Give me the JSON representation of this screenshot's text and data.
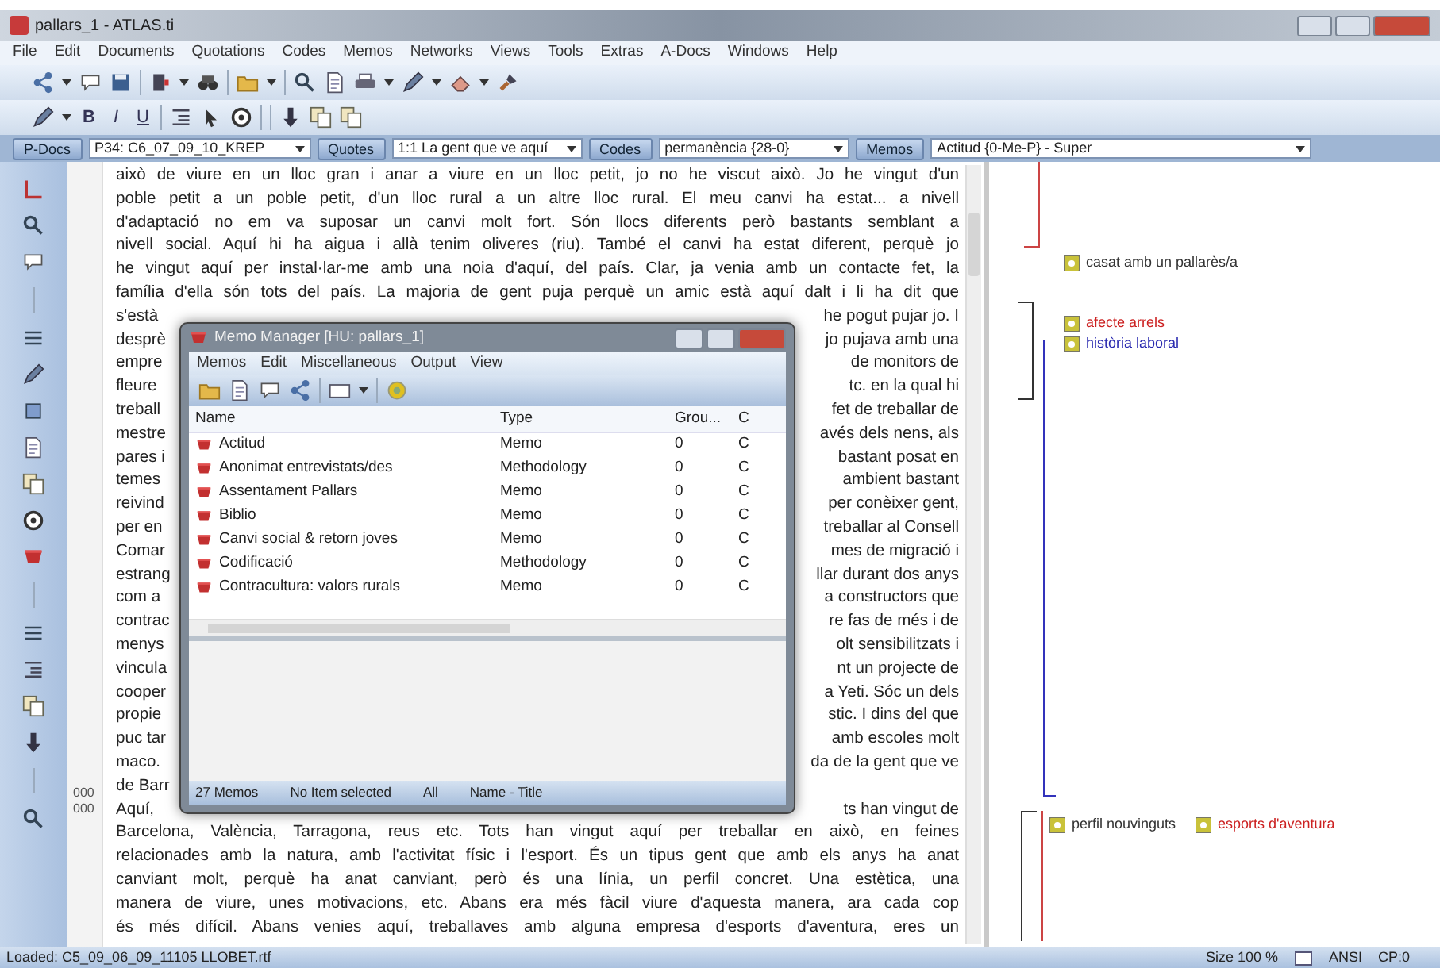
{
  "window": {
    "title": "pallars_1 - ATLAS.ti"
  },
  "menu": [
    "File",
    "Edit",
    "Documents",
    "Quotations",
    "Codes",
    "Memos",
    "Networks",
    "Views",
    "Tools",
    "Extras",
    "A-Docs",
    "Windows",
    "Help"
  ],
  "format_buttons": [
    "B",
    "I",
    "U"
  ],
  "selectors": [
    {
      "button": "P-Docs",
      "value": "P34: C6_07_09_10_KREP"
    },
    {
      "button": "Quotes",
      "value": "1:1 La gent que ve aquí"
    },
    {
      "button": "Codes",
      "value": "permanència {28-0}"
    },
    {
      "button": "Memos",
      "value": "Actitud {0-Me-P} - Super"
    }
  ],
  "document": {
    "lines": [
      {
        "kind": "full",
        "text": "això de viure en un lloc gran i anar a viure en un lloc petit, jo no he viscut això. Jo he vingut d'un"
      },
      {
        "kind": "full",
        "text": "poble petit a un poble petit, d'un lloc rural a un altre lloc rural. El meu canvi ha estat... a nivell"
      },
      {
        "kind": "full",
        "text": "d'adaptació no em va suposar un canvi molt fort. Són llocs diferents però bastants semblant a"
      },
      {
        "kind": "full",
        "text": "nivell social. Aquí hi ha aigua i allà tenim oliveres (riu). També el canvi ha estat diferent, perquè jo"
      },
      {
        "kind": "full",
        "text": "he vingut aquí per instal·lar-me amb una noia d'aquí, del país. Clar, ja venia amb un contacte fet, la"
      },
      {
        "kind": "full",
        "text": "família d'ella són tots del país. La majoria de gent puja perquè un amic està aquí dalt i li ha dit que"
      },
      {
        "kind": "split",
        "left": "s'està",
        "right": "he pogut pujar jo. I"
      },
      {
        "kind": "split",
        "left": "desprè",
        "right": "jo pujava amb una"
      },
      {
        "kind": "split",
        "left": "empre",
        "right": "de monitors de"
      },
      {
        "kind": "split",
        "left": "fleure",
        "right": "tc. en la qual hi"
      },
      {
        "kind": "split",
        "left": "treball",
        "right": "fet de treballar de"
      },
      {
        "kind": "split",
        "left": "mestre",
        "right": "avés dels nens, als"
      },
      {
        "kind": "split",
        "left": "pares i",
        "right": "bastant posat en"
      },
      {
        "kind": "split",
        "left": "temes",
        "right": "ambient bastant"
      },
      {
        "kind": "split",
        "left": "reivind",
        "right": "per conèixer gent,"
      },
      {
        "kind": "split",
        "left": "per en",
        "right": "treballar al Consell"
      },
      {
        "kind": "split",
        "left": "Comar",
        "right": "mes de migració i"
      },
      {
        "kind": "split",
        "left": "estrang",
        "right": "llar durant dos anys"
      },
      {
        "kind": "split",
        "left": "com a",
        "right": "a constructors que"
      },
      {
        "kind": "split",
        "left": "contrac",
        "right": "re fas de més i de"
      },
      {
        "kind": "split",
        "left": "menys",
        "right": "olt sensibilitzats i"
      },
      {
        "kind": "split",
        "left": "vincula",
        "right": "nt un projecte de"
      },
      {
        "kind": "split",
        "left": "cooper",
        "right": "a Yeti. Sóc un dels"
      },
      {
        "kind": "split",
        "left": "propie",
        "right": "stic. I dins del que"
      },
      {
        "kind": "split",
        "left": "puc tar",
        "right": "amb escoles molt"
      },
      {
        "kind": "split",
        "left": "maco.",
        "right": "da de la gent que ve"
      },
      {
        "kind": "split",
        "left": "de Barr"
      },
      {
        "kind": "split",
        "left": "Aquí,",
        "right": "ts han vingut de"
      },
      {
        "kind": "full",
        "text": "Barcelona, València, Tarragona, reus etc. Tots han vingut aquí per treballar en això, en feines"
      },
      {
        "kind": "full",
        "text": "relacionades amb la natura, amb l'activitat físic i l'esport. És un tipus gent que amb els anys ha anat"
      },
      {
        "kind": "full",
        "text": "canviant molt, perquè ha anat canviant, però és una línia, un perfil concret. Una estètica, una"
      },
      {
        "kind": "full",
        "text": "manera de viure, unes motivacions, etc. Abans era més fàcil viure d'aquesta manera, ara cada cop"
      },
      {
        "kind": "full",
        "text": "és més difícil. Abans venies aquí, treballaves amb alguna empresa d'esports d'aventura, eres un"
      }
    ],
    "gutter_marks": [
      "000",
      "000"
    ]
  },
  "margin": {
    "codes": [
      {
        "label": "casat amb un pallarès/a",
        "color": "#333333"
      },
      {
        "label": "afecte arrels",
        "color": "#cc2222"
      },
      {
        "label": "història laboral",
        "color": "#2b2bb0"
      },
      {
        "label": "perfil nouvinguts",
        "color": "#333333"
      },
      {
        "label": "esports d'aventura",
        "color": "#cc2222"
      }
    ]
  },
  "memo_manager": {
    "title": "Memo Manager [HU: pallars_1]",
    "menu": [
      "Memos",
      "Edit",
      "Miscellaneous",
      "Output",
      "View"
    ],
    "columns": [
      "Name",
      "Type",
      "Grou...",
      "C"
    ],
    "rows": [
      {
        "name": "Actitud",
        "type": "Memo",
        "groups": "0",
        "column_4": "C"
      },
      {
        "name": "Anonimat entrevistats/des",
        "type": "Methodology",
        "groups": "0",
        "column_4": "C"
      },
      {
        "name": "Assentament Pallars",
        "type": "Memo",
        "groups": "0",
        "column_4": "C"
      },
      {
        "name": "Biblio",
        "type": "Memo",
        "groups": "0",
        "column_4": "C"
      },
      {
        "name": "Canvi social & retorn joves",
        "type": "Memo",
        "groups": "0",
        "column_4": "C"
      },
      {
        "name": "Codificació",
        "type": "Methodology",
        "groups": "0",
        "column_4": "C"
      },
      {
        "name": "Contracultura: valors rurals",
        "type": "Memo",
        "groups": "0",
        "column_4": "C"
      }
    ],
    "status": [
      "27 Memos",
      "No Item selected",
      "All",
      "Name - Title"
    ]
  },
  "status_bar": {
    "file": "Loaded: C5_09_06_09_11105 LLOBET.rtf",
    "size": "Size 100 %",
    "encoding": "ANSI",
    "codepage": "CP:0"
  }
}
